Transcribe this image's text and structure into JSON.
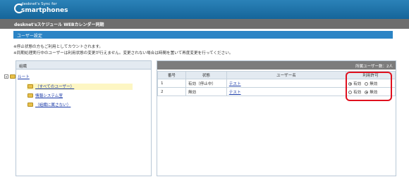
{
  "header": {
    "logo_line1": "desknet's Sync for",
    "logo_line2": "smartphones"
  },
  "subbar": {
    "title": "desknet'sスケジュール WEBカレンダー同期"
  },
  "section": {
    "title": "ユーザー設定"
  },
  "notes": [
    "※停止状態の方もご利用としてカウントされます。",
    "※同期処理実行中のユーザーは利用状態の変更が行えません。変更されない場合は時間を置いて再度変更を行ってください。"
  ],
  "tree": {
    "header": "組織",
    "root": "ルート",
    "items": [
      "（すべてのユーザー）",
      "情報システム室",
      "（組織に属さない）"
    ]
  },
  "users": {
    "count_label": "所属ユーザー数：2人",
    "columns": [
      "番号",
      "状態",
      "ユーザー名",
      "利用許可"
    ],
    "option_labels": [
      "有効",
      "無効"
    ],
    "rows": [
      {
        "num": "1",
        "status": "有効（停止中）",
        "name": "テスト",
        "selected": "有効"
      },
      {
        "num": "2",
        "status": "無効",
        "name": "テスト",
        "selected": "無効"
      }
    ]
  }
}
